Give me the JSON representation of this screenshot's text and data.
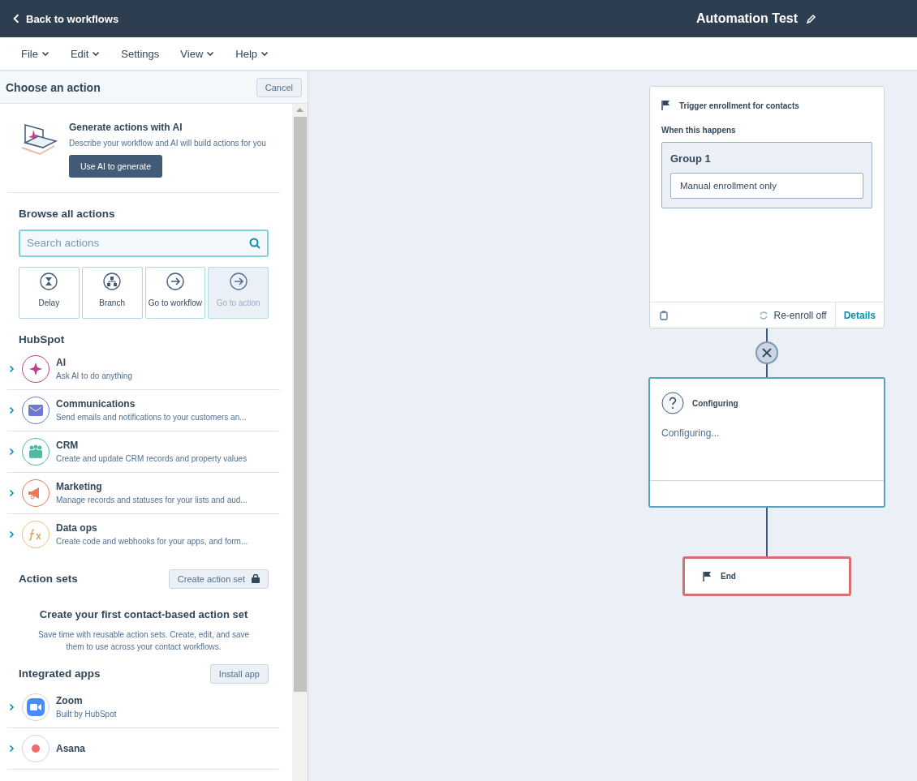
{
  "top_bar": {
    "back_link": "Back to workflows",
    "title": "Automation Test"
  },
  "menu": [
    {
      "label": "File",
      "has_menu": true
    },
    {
      "label": "Edit",
      "has_menu": true
    },
    {
      "label": "Settings",
      "has_menu": false
    },
    {
      "label": "View",
      "has_menu": true
    },
    {
      "label": "Help",
      "has_menu": true
    }
  ],
  "action_panel": {
    "title": "Choose an action",
    "cancel": "Cancel",
    "ai_promo": {
      "title": "Generate actions with AI",
      "description": "Describe your workflow and AI will build actions for you",
      "button": "Use AI to generate"
    },
    "browse": {
      "title": "Browse all actions",
      "search_placeholder": "Search actions",
      "quick_actions": [
        {
          "label": "Delay",
          "kind": "delay",
          "disabled": false
        },
        {
          "label": "Branch",
          "kind": "branch",
          "disabled": false
        },
        {
          "label": "Go to workflow",
          "kind": "goto",
          "disabled": false
        },
        {
          "label": "Go to action",
          "kind": "goto",
          "disabled": true
        }
      ]
    },
    "hubspot": {
      "title": "HubSpot",
      "categories": [
        {
          "name": "AI",
          "description": "Ask AI to do anything",
          "kind": "ai"
        },
        {
          "name": "Communications",
          "description": "Send emails and notifications to your customers an...",
          "kind": "mail"
        },
        {
          "name": "CRM",
          "description": "Create and update CRM records and property values",
          "kind": "crm"
        },
        {
          "name": "Marketing",
          "description": "Manage records and statuses for your lists and aud...",
          "kind": "marketing"
        },
        {
          "name": "Data ops",
          "description": "Create code and webhooks for your apps, and form...",
          "kind": "dataops"
        }
      ]
    },
    "action_sets": {
      "title": "Action sets",
      "button": "Create action set",
      "empty_title": "Create your first contact-based action set",
      "empty_text": "Save time with reusable action sets. Create, edit, and save them to use across your contact workflows."
    },
    "integrated_apps": {
      "title": "Integrated apps",
      "button": "Install app",
      "apps": [
        {
          "name": "Zoom",
          "description": "Built by HubSpot",
          "kind": "zoom"
        },
        {
          "name": "Asana",
          "kind": "asana"
        }
      ]
    }
  },
  "canvas": {
    "trigger": {
      "title": "Trigger enrollment for contacts",
      "subtitle": "When this happens",
      "group_title": "Group 1",
      "condition": "Manual enrollment only",
      "reenroll": "Re-enroll off",
      "details": "Details"
    },
    "configuring": {
      "title": "Configuring",
      "body": "Configuring..."
    },
    "end": {
      "title": "End"
    }
  }
}
